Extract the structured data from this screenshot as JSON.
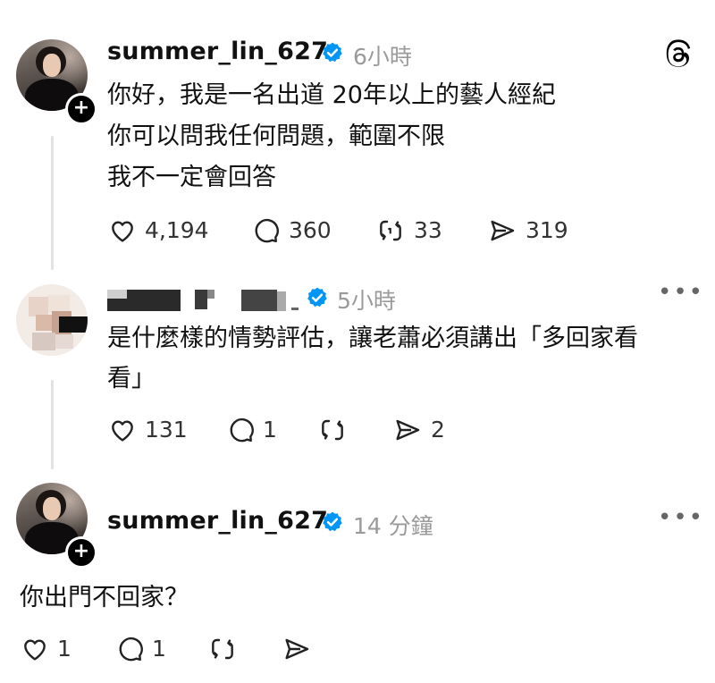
{
  "posts": [
    {
      "username": "summer_lin_627",
      "time": "6小時",
      "lines": [
        "你好，我是一名出道 20年以上的藝人經紀",
        "你可以問我任何問題，範圍不限",
        "我不一定會回答"
      ],
      "likes": "4,194",
      "comments": "360",
      "reposts": "33",
      "shares": "319"
    },
    {
      "username": "",
      "time": "5小時",
      "lines": [
        "是什麼樣的情勢評估，讓老蕭必須講出「多回家看",
        "看」"
      ],
      "likes": "131",
      "comments": "1",
      "reposts": "",
      "shares": "2"
    },
    {
      "username": "summer_lin_627",
      "time": "14 分鐘",
      "lines": [
        "你出門不回家？"
      ],
      "likes": "1",
      "comments": "1",
      "reposts": "",
      "shares": ""
    }
  ],
  "icons": {
    "like": "heart-icon",
    "comment": "comment-bubble-icon",
    "repost": "repost-icon",
    "share": "share-send-icon",
    "brand": "threads-logo-icon",
    "more": "more-options-icon",
    "verified": "verified-badge-icon"
  },
  "colors": {
    "verified": "#0095f6",
    "muted": "#9a9a9a",
    "text": "#111111"
  }
}
